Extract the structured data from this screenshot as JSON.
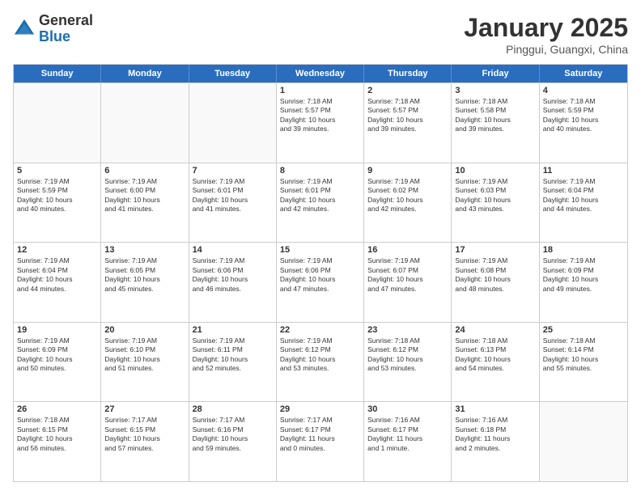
{
  "logo": {
    "general": "General",
    "blue": "Blue"
  },
  "title": {
    "month": "January 2025",
    "location": "Pinggui, Guangxi, China"
  },
  "header_days": [
    "Sunday",
    "Monday",
    "Tuesday",
    "Wednesday",
    "Thursday",
    "Friday",
    "Saturday"
  ],
  "weeks": [
    [
      {
        "num": "",
        "info": "",
        "empty": true
      },
      {
        "num": "",
        "info": "",
        "empty": true
      },
      {
        "num": "",
        "info": "",
        "empty": true
      },
      {
        "num": "1",
        "info": "Sunrise: 7:18 AM\nSunset: 5:57 PM\nDaylight: 10 hours\nand 39 minutes."
      },
      {
        "num": "2",
        "info": "Sunrise: 7:18 AM\nSunset: 5:57 PM\nDaylight: 10 hours\nand 39 minutes."
      },
      {
        "num": "3",
        "info": "Sunrise: 7:18 AM\nSunset: 5:58 PM\nDaylight: 10 hours\nand 39 minutes."
      },
      {
        "num": "4",
        "info": "Sunrise: 7:18 AM\nSunset: 5:59 PM\nDaylight: 10 hours\nand 40 minutes."
      }
    ],
    [
      {
        "num": "5",
        "info": "Sunrise: 7:19 AM\nSunset: 5:59 PM\nDaylight: 10 hours\nand 40 minutes."
      },
      {
        "num": "6",
        "info": "Sunrise: 7:19 AM\nSunset: 6:00 PM\nDaylight: 10 hours\nand 41 minutes."
      },
      {
        "num": "7",
        "info": "Sunrise: 7:19 AM\nSunset: 6:01 PM\nDaylight: 10 hours\nand 41 minutes."
      },
      {
        "num": "8",
        "info": "Sunrise: 7:19 AM\nSunset: 6:01 PM\nDaylight: 10 hours\nand 42 minutes."
      },
      {
        "num": "9",
        "info": "Sunrise: 7:19 AM\nSunset: 6:02 PM\nDaylight: 10 hours\nand 42 minutes."
      },
      {
        "num": "10",
        "info": "Sunrise: 7:19 AM\nSunset: 6:03 PM\nDaylight: 10 hours\nand 43 minutes."
      },
      {
        "num": "11",
        "info": "Sunrise: 7:19 AM\nSunset: 6:04 PM\nDaylight: 10 hours\nand 44 minutes."
      }
    ],
    [
      {
        "num": "12",
        "info": "Sunrise: 7:19 AM\nSunset: 6:04 PM\nDaylight: 10 hours\nand 44 minutes."
      },
      {
        "num": "13",
        "info": "Sunrise: 7:19 AM\nSunset: 6:05 PM\nDaylight: 10 hours\nand 45 minutes."
      },
      {
        "num": "14",
        "info": "Sunrise: 7:19 AM\nSunset: 6:06 PM\nDaylight: 10 hours\nand 46 minutes."
      },
      {
        "num": "15",
        "info": "Sunrise: 7:19 AM\nSunset: 6:06 PM\nDaylight: 10 hours\nand 47 minutes."
      },
      {
        "num": "16",
        "info": "Sunrise: 7:19 AM\nSunset: 6:07 PM\nDaylight: 10 hours\nand 47 minutes."
      },
      {
        "num": "17",
        "info": "Sunrise: 7:19 AM\nSunset: 6:08 PM\nDaylight: 10 hours\nand 48 minutes."
      },
      {
        "num": "18",
        "info": "Sunrise: 7:19 AM\nSunset: 6:09 PM\nDaylight: 10 hours\nand 49 minutes."
      }
    ],
    [
      {
        "num": "19",
        "info": "Sunrise: 7:19 AM\nSunset: 6:09 PM\nDaylight: 10 hours\nand 50 minutes."
      },
      {
        "num": "20",
        "info": "Sunrise: 7:19 AM\nSunset: 6:10 PM\nDaylight: 10 hours\nand 51 minutes."
      },
      {
        "num": "21",
        "info": "Sunrise: 7:19 AM\nSunset: 6:11 PM\nDaylight: 10 hours\nand 52 minutes."
      },
      {
        "num": "22",
        "info": "Sunrise: 7:19 AM\nSunset: 6:12 PM\nDaylight: 10 hours\nand 53 minutes."
      },
      {
        "num": "23",
        "info": "Sunrise: 7:18 AM\nSunset: 6:12 PM\nDaylight: 10 hours\nand 53 minutes."
      },
      {
        "num": "24",
        "info": "Sunrise: 7:18 AM\nSunset: 6:13 PM\nDaylight: 10 hours\nand 54 minutes."
      },
      {
        "num": "25",
        "info": "Sunrise: 7:18 AM\nSunset: 6:14 PM\nDaylight: 10 hours\nand 55 minutes."
      }
    ],
    [
      {
        "num": "26",
        "info": "Sunrise: 7:18 AM\nSunset: 6:15 PM\nDaylight: 10 hours\nand 56 minutes."
      },
      {
        "num": "27",
        "info": "Sunrise: 7:17 AM\nSunset: 6:15 PM\nDaylight: 10 hours\nand 57 minutes."
      },
      {
        "num": "28",
        "info": "Sunrise: 7:17 AM\nSunset: 6:16 PM\nDaylight: 10 hours\nand 59 minutes."
      },
      {
        "num": "29",
        "info": "Sunrise: 7:17 AM\nSunset: 6:17 PM\nDaylight: 11 hours\nand 0 minutes."
      },
      {
        "num": "30",
        "info": "Sunrise: 7:16 AM\nSunset: 6:17 PM\nDaylight: 11 hours\nand 1 minute."
      },
      {
        "num": "31",
        "info": "Sunrise: 7:16 AM\nSunset: 6:18 PM\nDaylight: 11 hours\nand 2 minutes."
      },
      {
        "num": "",
        "info": "",
        "empty": true
      }
    ]
  ]
}
